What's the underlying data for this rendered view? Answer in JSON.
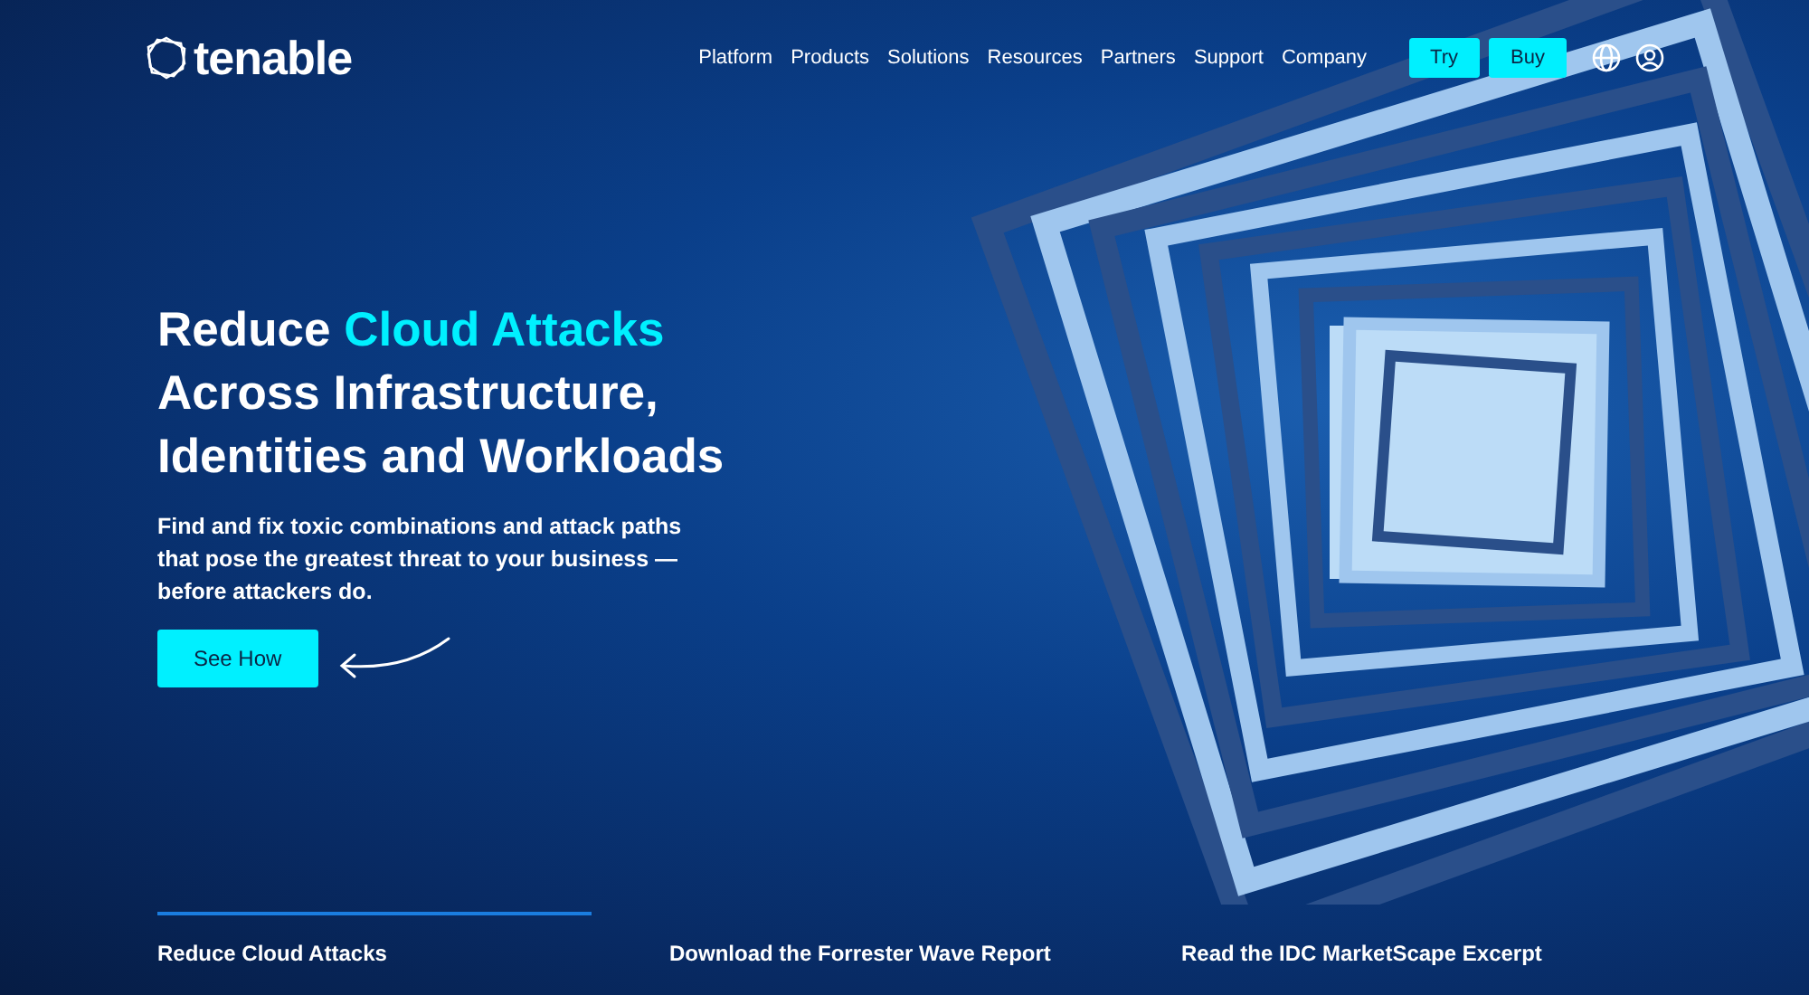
{
  "header": {
    "logo": "tenable",
    "nav": [
      "Platform",
      "Products",
      "Solutions",
      "Resources",
      "Partners",
      "Support",
      "Company"
    ],
    "buttons": [
      "Try",
      "Buy"
    ]
  },
  "hero": {
    "headline_lead": "Reduce ",
    "headline_highlight": "Cloud Attacks",
    "headline_rest": "Across Infrastructure, Identities and Workloads",
    "body": "Find and fix toxic combinations and attack paths that pose the greatest threat to your business — before attackers do.",
    "cta": "See How"
  },
  "slides": [
    {
      "label": "Reduce Cloud Attacks",
      "selected": true
    },
    {
      "label": "Download the Forrester Wave Report",
      "selected": false
    },
    {
      "label": "Read the IDC MarketScape Excerpt",
      "selected": false
    }
  ]
}
